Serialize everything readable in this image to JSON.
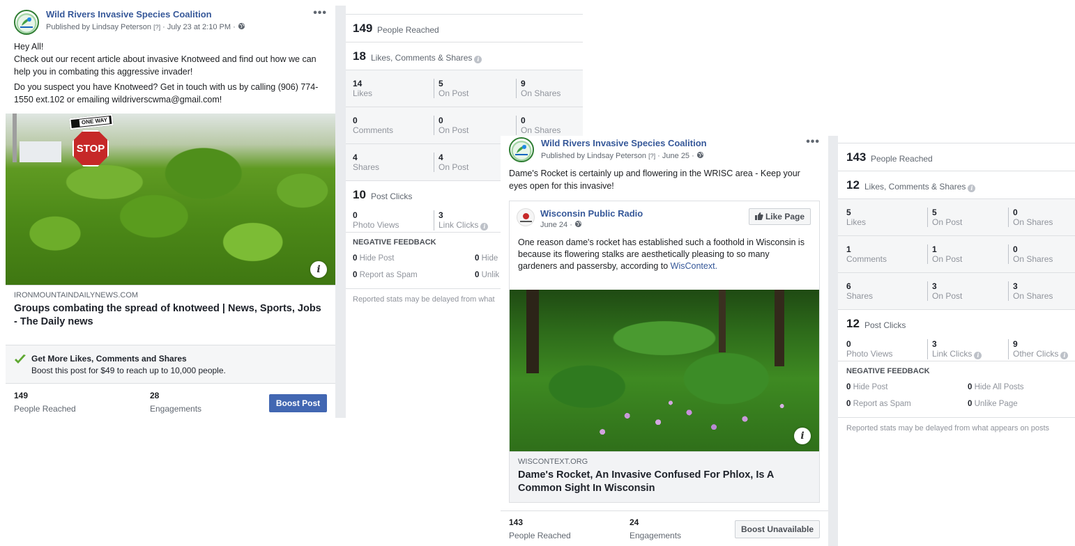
{
  "post1": {
    "page_name": "Wild Rivers Invasive Species Coalition",
    "published_by": "Published by Lindsay Peterson",
    "help_marker": "[?]",
    "date": "July 23 at 2:10 PM",
    "more": "•••",
    "text_lines": [
      "Hey All!",
      "Check out our recent article about invasive Knotweed and find out how we can help you in combating this aggressive invader!",
      "Do you suspect you have Knotweed? Get in touch with us by calling (906) 774-1550 ext.102 or emailing wildriverscwma@gmail.com!"
    ],
    "sign_one_way": "ONE WAY",
    "sign_stop": "STOP",
    "link_domain": "IRONMOUNTAINDAILYNEWS.COM",
    "link_title": "Groups combating the spread of knotweed | News, Sports, Jobs - The Daily news",
    "boost_title": "Get More Likes, Comments and Shares",
    "boost_sub": "Boost this post for $49 to reach up to 10,000 people.",
    "reached_value": "149",
    "reached_label": "People Reached",
    "engagements_value": "28",
    "engagements_label": "Engagements",
    "boost_button": "Boost Post"
  },
  "stats1": {
    "reached_value": "149",
    "reached_label": "People Reached",
    "lcs_value": "18",
    "lcs_label": "Likes, Comments & Shares",
    "rows": [
      [
        {
          "n": "14",
          "l": "Likes"
        },
        {
          "n": "5",
          "l": "On Post"
        },
        {
          "n": "9",
          "l": "On Shares"
        }
      ],
      [
        {
          "n": "0",
          "l": "Comments"
        },
        {
          "n": "0",
          "l": "On Post"
        },
        {
          "n": "0",
          "l": "On Shares"
        }
      ],
      [
        {
          "n": "4",
          "l": "Shares"
        },
        {
          "n": "4",
          "l": "On Post"
        }
      ]
    ],
    "clicks_value": "10",
    "clicks_label": "Post Clicks",
    "photo_views_value": "0",
    "photo_views_label": "Photo Views",
    "link_clicks_value": "3",
    "link_clicks_label": "Link Clicks",
    "neg_title": "NEGATIVE FEEDBACK",
    "hide_post_value": "0",
    "hide_post_label": "Hide Post",
    "hide_all_value": "0",
    "hide_all_label": "Hide",
    "spam_value": "0",
    "spam_label": "Report as Spam",
    "unlike_value": "0",
    "unlike_label": "Unlik",
    "note": "Reported stats may be delayed from what"
  },
  "post2": {
    "page_name": "Wild Rivers Invasive Species Coalition",
    "published_by": "Published by Lindsay Peterson",
    "help_marker": "[?]",
    "date": "June 25",
    "more": "•••",
    "text": "Dame's Rocket is certainly up and flowering in the WRISC area - Keep your eyes open for this invasive!",
    "shared_page": "Wisconsin Public Radio",
    "shared_date": "June 24",
    "like_page": "Like Page",
    "shared_text": "One reason dame's rocket has established such a foothold in Wisconsin is because its flowering stalks are aesthetically pleasing to so many gardeners and passersby, according to",
    "shared_link": "WisContext.",
    "link_domain": "WISCONTEXT.ORG",
    "link_title": "Dame's Rocket, An Invasive Confused For Phlox, Is A Common Sight In Wisconsin",
    "reached_value": "143",
    "reached_label": "People Reached",
    "engagements_value": "24",
    "engagements_label": "Engagements",
    "boost_button": "Boost Unavailable"
  },
  "stats2": {
    "reached_value": "143",
    "reached_label": "People Reached",
    "lcs_value": "12",
    "lcs_label": "Likes, Comments & Shares",
    "rows": [
      [
        {
          "n": "5",
          "l": "Likes"
        },
        {
          "n": "5",
          "l": "On Post"
        },
        {
          "n": "0",
          "l": "On Shares"
        }
      ],
      [
        {
          "n": "1",
          "l": "Comments"
        },
        {
          "n": "1",
          "l": "On Post"
        },
        {
          "n": "0",
          "l": "On Shares"
        }
      ],
      [
        {
          "n": "6",
          "l": "Shares"
        },
        {
          "n": "3",
          "l": "On Post"
        },
        {
          "n": "3",
          "l": "On Shares"
        }
      ]
    ],
    "clicks_value": "12",
    "clicks_label": "Post Clicks",
    "photo_views_value": "0",
    "photo_views_label": "Photo Views",
    "link_clicks_value": "3",
    "link_clicks_label": "Link Clicks",
    "other_clicks_value": "9",
    "other_clicks_label": "Other Clicks",
    "neg_title": "NEGATIVE FEEDBACK",
    "hide_post_value": "0",
    "hide_post_label": "Hide Post",
    "hide_all_value": "0",
    "hide_all_label": "Hide All Posts",
    "spam_value": "0",
    "spam_label": "Report as Spam",
    "unlike_value": "0",
    "unlike_label": "Unlike Page",
    "note": "Reported stats may be delayed from what appears on posts"
  },
  "colors": {
    "link_blue": "#365899",
    "boost_blue": "#4267b2",
    "check_green": "#5fa832"
  },
  "icons": [
    "globe-icon",
    "info-icon",
    "check-icon",
    "thumbs-up-icon",
    "more-icon"
  ]
}
